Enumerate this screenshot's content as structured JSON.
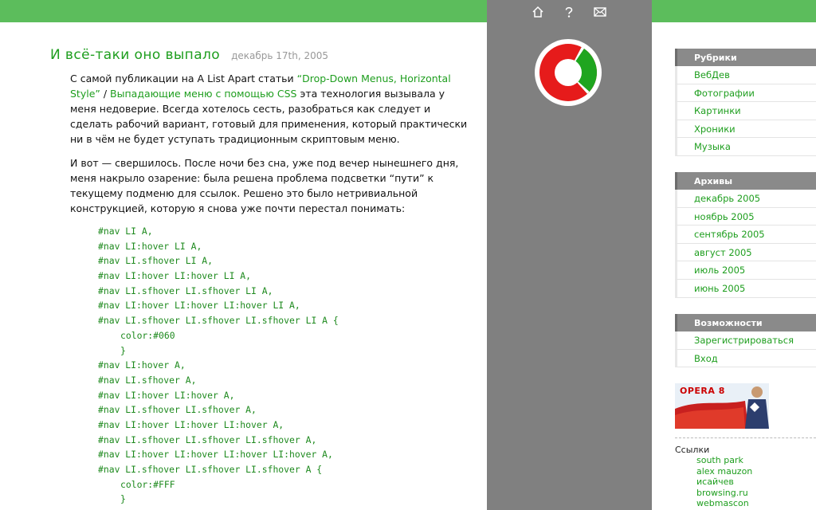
{
  "colors": {
    "accent": "#1e9e1e",
    "topbar": "#5cbd5c",
    "center_column": "#808080"
  },
  "top_icons": [
    {
      "name": "home-icon"
    },
    {
      "name": "help-icon"
    },
    {
      "name": "mail-icon"
    }
  ],
  "post": {
    "title": "И всё-таки оно выпало",
    "date": "декабрь 17th, 2005",
    "p1": {
      "before_link1": "С самой публикации на A List Apart статьи ",
      "link1": "“Drop-Down Menus, Horizontal Style”",
      "between": " / ",
      "link2": "Выпадающие меню с помощью CSS",
      "after": " эта технология вызывала у меня недоверие. Всегда хотелось сесть, разобраться как следует и сделать рабочий вариант, готовый для применения, который практически ни в чём не будет уступать традиционным скриптовым меню."
    },
    "p2": "И вот — свершилось. После ночи без сна, уже под вечер нынешнего дня, меня накрыло озарение: была решена проблема подсветки “пути” к текущему подменю для ссылок. Решено это было нетривиальной конструкцией, которую я снова уже почти перестал понимать:",
    "code_lines": [
      "#nav LI A,",
      "#nav LI:hover LI A,",
      "#nav LI.sfhover LI A,",
      "#nav LI:hover LI:hover LI A,",
      "#nav LI.sfhover LI.sfhover LI A,",
      "#nav LI:hover LI:hover LI:hover LI A,",
      "#nav LI.sfhover LI.sfhover LI.sfhover LI A {",
      "color:#060",
      "}",
      "#nav LI:hover A,",
      "#nav LI.sfhover A,",
      "#nav LI:hover LI:hover A,",
      "#nav LI.sfhover LI.sfhover A,",
      "#nav LI:hover LI:hover LI:hover A,",
      "#nav LI.sfhover LI.sfhover LI.sfhover A,",
      "#nav LI:hover LI:hover LI:hover LI:hover A,",
      "#nav LI.sfhover LI.sfhover LI.sfhover A {",
      "color:#FFF",
      "}"
    ]
  },
  "sidebar": {
    "rubrics": {
      "title": "Рубрики",
      "items": [
        "ВебДев",
        "Фотографии",
        "Картинки",
        "Хроники",
        "Музыка"
      ]
    },
    "archives": {
      "title": "Архивы",
      "items": [
        "декабрь 2005",
        "ноябрь 2005",
        "сентябрь 2005",
        "август 2005",
        "июль 2005",
        "июнь 2005"
      ]
    },
    "features": {
      "title": "Возможности",
      "items": [
        "Зарегистрироваться",
        "Вход"
      ]
    },
    "banner_text": "OPERA 8",
    "links": {
      "title": "Ссылки",
      "items": [
        "south park",
        "alex mauzon",
        "исайчев",
        "browsing.ru",
        "webmascon"
      ]
    }
  }
}
